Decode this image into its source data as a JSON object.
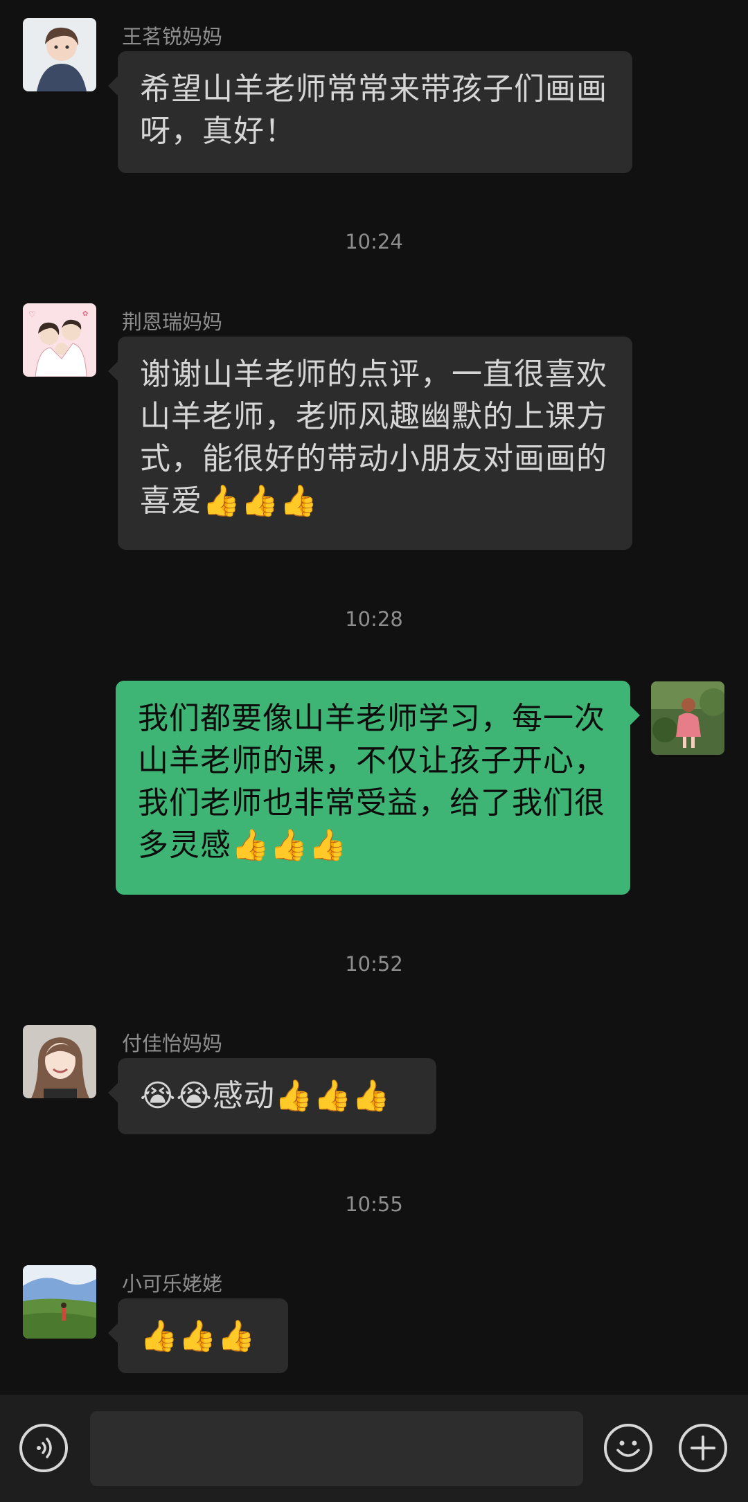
{
  "colors": {
    "background": "#111111",
    "bubble_other": "#2c2c2c",
    "bubble_me": "#3eb575",
    "meta_text": "#8e8e8e"
  },
  "messages": [
    {
      "sender": "王茗锐妈妈",
      "text": "希望山羊老师常常来带孩子们画画呀，真好！"
    },
    {
      "time": "10:24"
    },
    {
      "sender": "荆恩瑞妈妈",
      "text": "谢谢山羊老师的点评，一直很喜欢山羊老师，老师风趣幽默的上课方式，能很好的带动小朋友对画画的喜爱",
      "text_line1": "谢谢山羊老师的点评，一直很喜欢",
      "text_line2": "山羊老师，老师风趣幽默的上课方",
      "text_line3": "式，能很好的带动小朋友对画画的",
      "text_line4": "喜爱",
      "emoji": "👍👍👍"
    },
    {
      "time": "10:28"
    },
    {
      "sender": "",
      "text_line1": "我们都要像山羊老师学习，每一次",
      "text_line2": "山羊老师的课，不仅让孩子开心，",
      "text_line3": "我们老师也非常受益，给了我们很",
      "text_line4": "多灵感",
      "emoji": "👍👍👍"
    },
    {
      "time": "10:52"
    },
    {
      "sender": "付佳怡妈妈",
      "emoji_pre": "😭😭",
      "text": "感动",
      "emoji": "👍👍👍"
    },
    {
      "time": "10:55"
    },
    {
      "sender": "小可乐姥姥",
      "emoji": "👍👍👍"
    }
  ],
  "msg1": {
    "line1": "希望山羊老师常常来带孩子们画画",
    "line2": "呀，真好！"
  },
  "input": {
    "value": "",
    "voice_icon": "voice-icon",
    "emoji_icon": "emoji-icon",
    "plus_icon": "plus-icon"
  }
}
